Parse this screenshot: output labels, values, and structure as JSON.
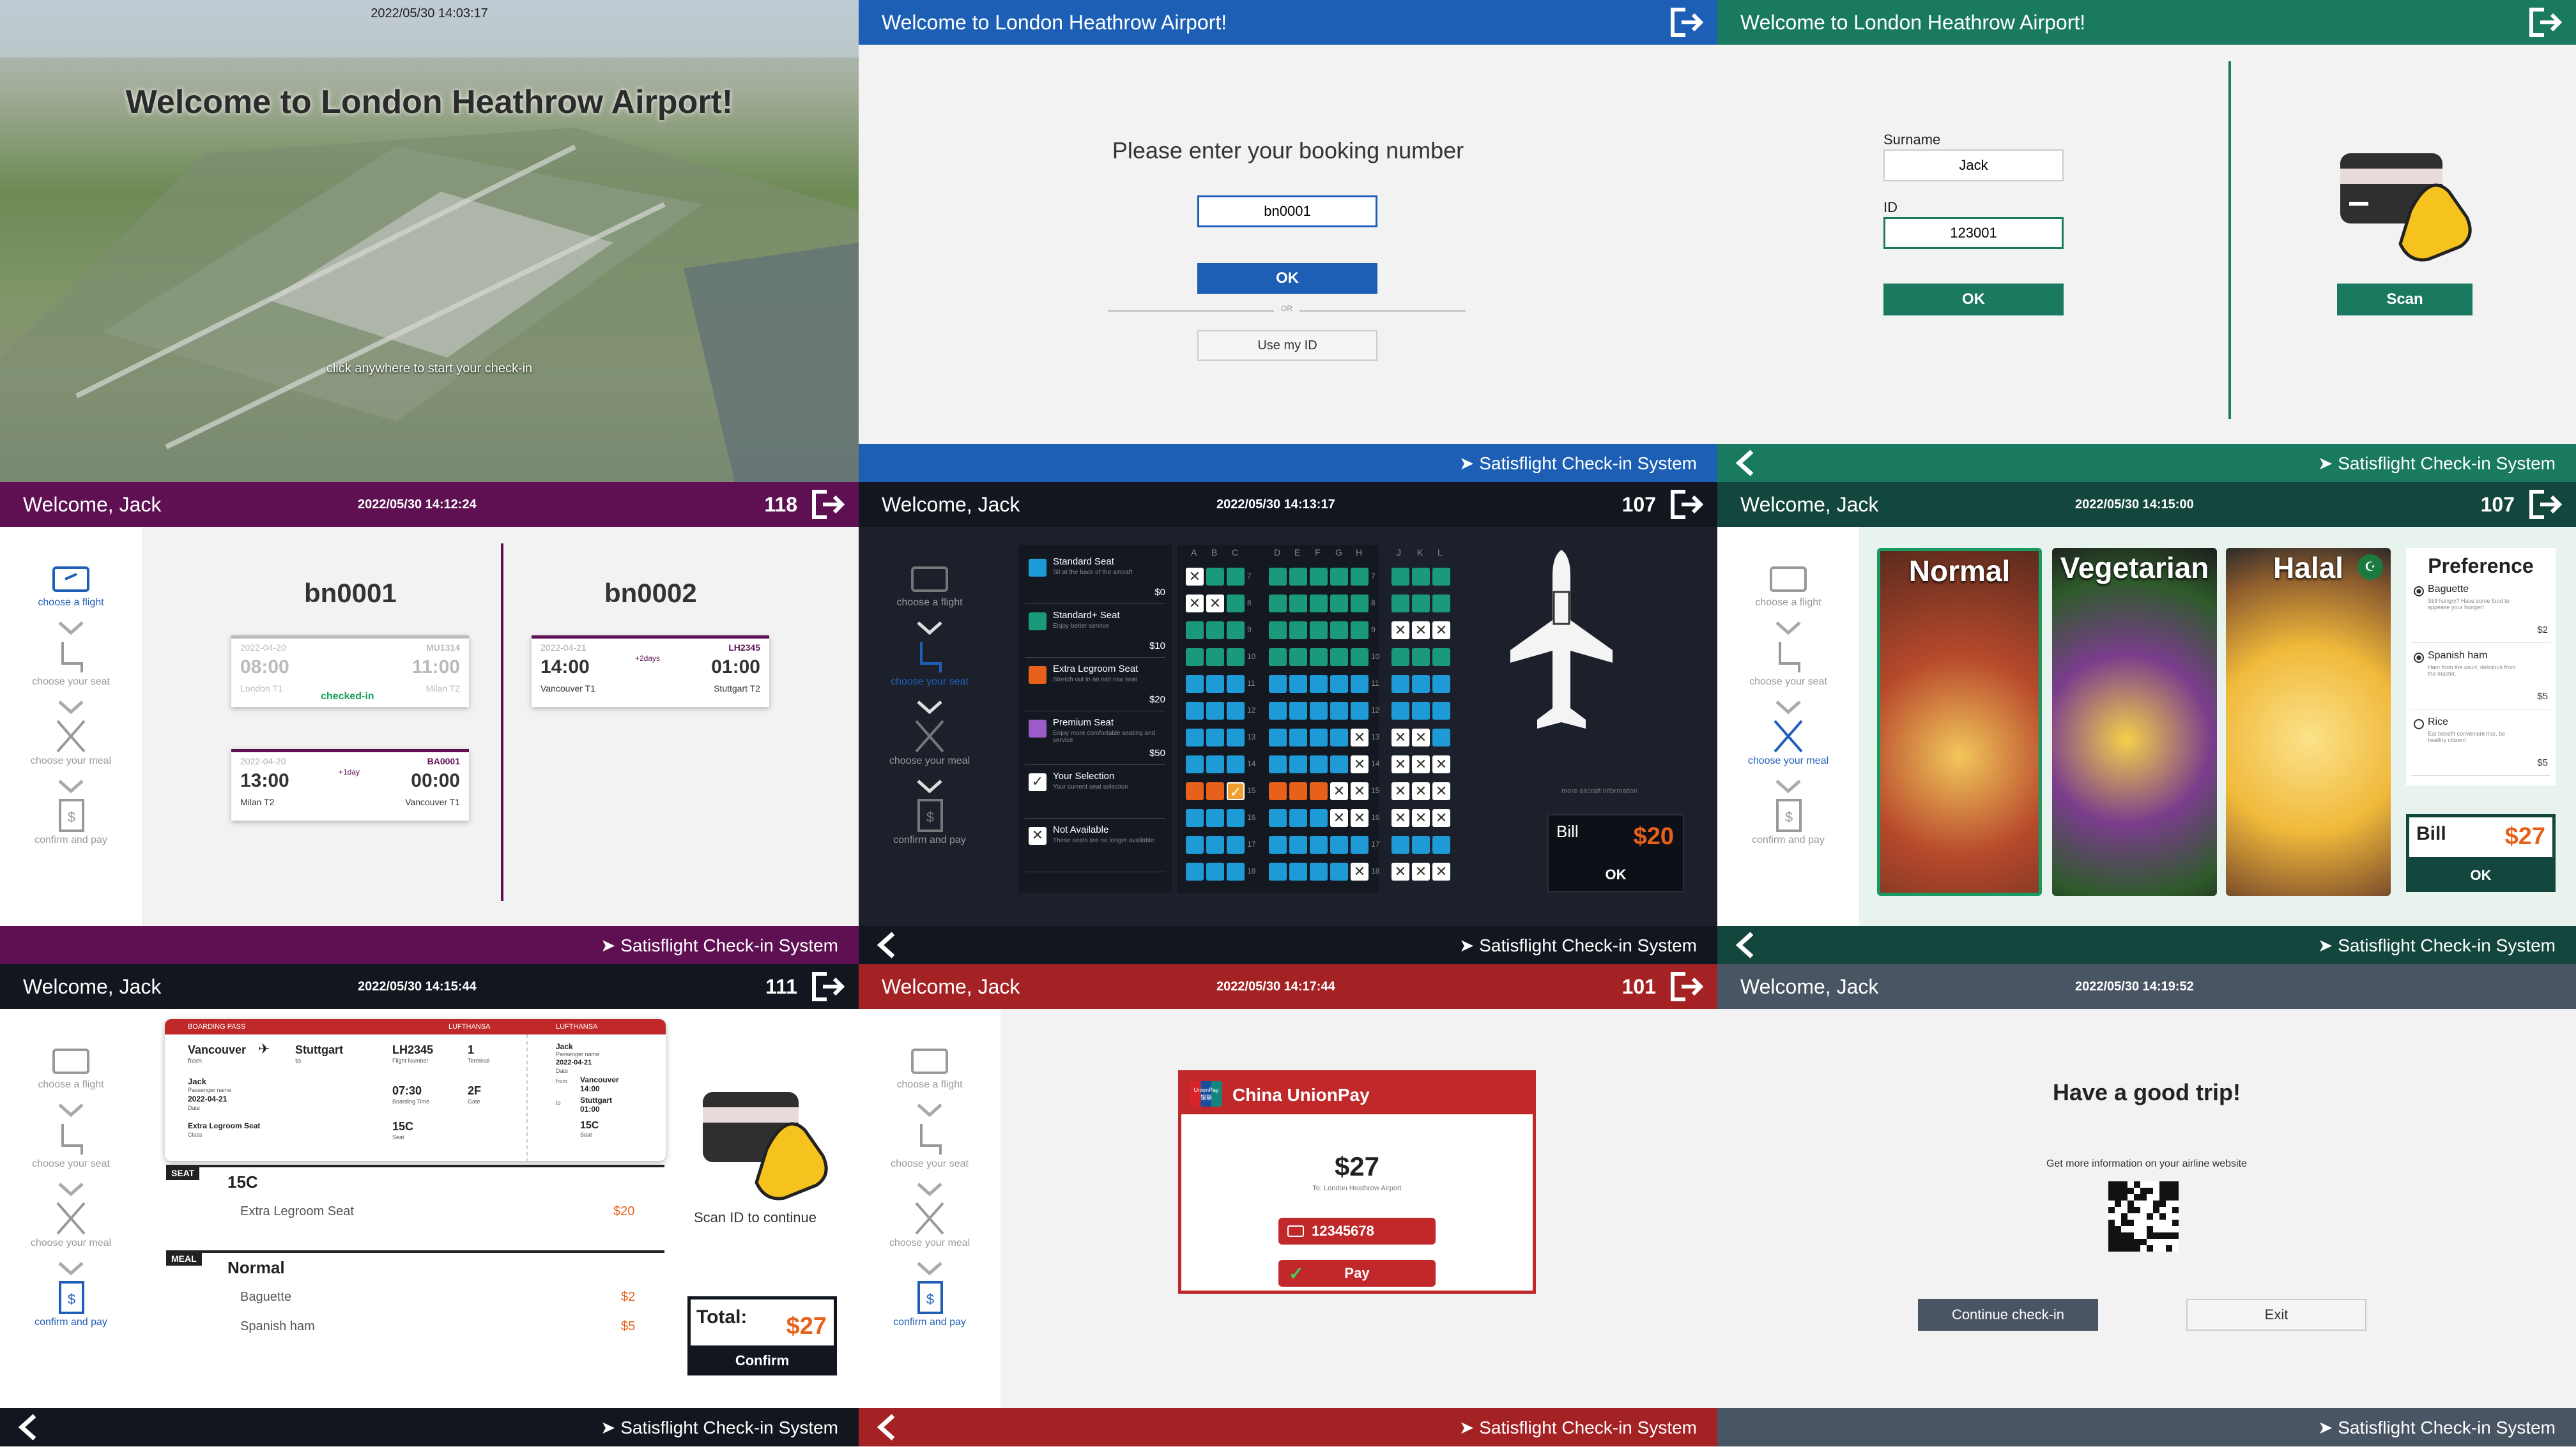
{
  "colors": {
    "blue": "#1d5fb4",
    "green": "#1a7a5f",
    "purple": "#5e1052",
    "navy": "#11161f",
    "darkgreen": "#13473e",
    "red": "#a52224",
    "slate": "#4a5563",
    "accent_orange": "#e8611b"
  },
  "p1": {
    "timestamp": "2022/05/30  14:03:17",
    "title": "Welcome to London Heathrow Airport!",
    "hint": "click anywhere to start your check-in"
  },
  "p2": {
    "header": "Welcome to London Heathrow Airport!",
    "prompt": "Please enter your booking number",
    "booking_value": "bn0001",
    "ok": "OK",
    "or": "OR",
    "use_id": "Use my ID",
    "brand": "Satisflight Check-in System"
  },
  "p3": {
    "header": "Welcome to London Heathrow Airport!",
    "surname_label": "Surname",
    "surname_value": "Jack",
    "id_label": "ID",
    "id_value": "123001",
    "ok": "OK",
    "scan": "Scan",
    "brand": "Satisflight Check-in System"
  },
  "steps": {
    "flight": "choose a flight",
    "seat": "choose your seat",
    "meal": "choose your meal",
    "pay": "confirm and pay"
  },
  "p4": {
    "welcome": "Welcome, Jack",
    "timestamp": "2022/05/30  14:12:24",
    "counter": "118",
    "brand": "Satisflight Check-in System",
    "booking1": "bn0001",
    "booking2": "bn0002",
    "t1": {
      "date": "2022-04-20",
      "code": "MU1314",
      "dep": "08:00",
      "arr": "11:00",
      "from": "London T1",
      "to": "Milan T2",
      "status": "checked-in"
    },
    "t2": {
      "date": "2022-04-20",
      "code": "BA0001",
      "dep": "13:00",
      "arr": "00:00",
      "from": "Milan T2",
      "to": "Vancouver T1",
      "extra": "+1day"
    },
    "t3": {
      "date": "2022-04-21",
      "code": "LH2345",
      "dep": "14:00",
      "arr": "01:00",
      "from": "Vancouver T1",
      "to": "Stuttgart T2",
      "extra": "+2days"
    }
  },
  "p5": {
    "welcome": "Welcome, Jack",
    "timestamp": "2022/05/30  14:13:17",
    "counter": "107",
    "brand": "Satisflight Check-in System",
    "legend": [
      {
        "name": "Standard Seat",
        "desc": "Sit at the back of the aircraft",
        "price": "$0"
      },
      {
        "name": "Standard+ Seat",
        "desc": "Enjoy better service",
        "price": "$10"
      },
      {
        "name": "Extra Legroom Seat",
        "desc": "Stretch out in an exit row seat",
        "price": "$20"
      },
      {
        "name": "Premium Seat",
        "desc": "Enjoy more comfortable seating and service",
        "price": "$50"
      },
      {
        "name": "Your Selection",
        "desc": "Your current seat selection",
        "price": ""
      },
      {
        "name": "Not Available",
        "desc": "These seats are no longer available",
        "price": ""
      }
    ],
    "cols": [
      "A",
      "B",
      "C",
      "D",
      "E",
      "F",
      "G",
      "H",
      "J",
      "K",
      "L"
    ],
    "rows": [
      "7",
      "8",
      "9",
      "10",
      "11",
      "12",
      "13",
      "14",
      "15",
      "16",
      "17",
      "18"
    ],
    "more": "more aircraft information",
    "bill": "Bill",
    "amount": "$20",
    "ok": "OK"
  },
  "p6": {
    "welcome": "Welcome, Jack",
    "timestamp": "2022/05/30  14:15:00",
    "counter": "107",
    "brand": "Satisflight Check-in System",
    "meals": [
      "Normal",
      "Vegetarian",
      "Halal"
    ],
    "pref_title": "Preference",
    "prefs": [
      {
        "name": "Baguette",
        "desc": "Still hungry? Have some food to appease your hunger!",
        "price": "$2"
      },
      {
        "name": "Spanish ham",
        "desc": "Ham from the court, delicious from the master.",
        "price": "$5"
      },
      {
        "name": "Rice",
        "desc": "Eat benefit convenient rice, be healthy citizen!",
        "price": "$5"
      }
    ],
    "bill": "Bill",
    "amount": "$27",
    "ok": "OK"
  },
  "p7": {
    "welcome": "Welcome, Jack",
    "timestamp": "2022/05/30  14:15:44",
    "counter": "111",
    "brand": "Satisflight Check-in System",
    "bp": {
      "head": "BOARDING PASS",
      "airline": "LUFTHANSA",
      "from": "Vancouver",
      "to": "Stuttgart",
      "from_sub": "from",
      "to_sub": "to",
      "flight": "LH2345",
      "flight_sub": "Flight Number",
      "terminal": "1",
      "terminal_sub": "Terminal",
      "name": "Jack",
      "name_sub": "Passenger name",
      "date": "2022-04-21",
      "date_sub": "Date",
      "boarding": "07:30",
      "boarding_sub": "Boarding Time",
      "gate": "2F",
      "gate_sub": "Gate",
      "class": "Extra Legroom Seat",
      "class_sub": "Class",
      "seat": "15C",
      "seat_sub": "Seat",
      "stub": {
        "name": "Jack",
        "name_sub": "Passenger name",
        "date": "2022-04-21",
        "date_sub": "Date",
        "from_label": "from",
        "from": "Vancouver",
        "dep": "14:00",
        "to_label": "to",
        "to": "Stuttgart",
        "arr": "01:00",
        "seat": "15C",
        "seat_sub": "Seat"
      }
    },
    "seat_tag": "SEAT",
    "seat_val": "15C",
    "seat_item": "Extra Legroom Seat",
    "seat_price": "$20",
    "meal_tag": "MEAL",
    "meal_val": "Normal",
    "meal_items": [
      {
        "name": "Baguette",
        "price": "$2"
      },
      {
        "name": "Spanish ham",
        "price": "$5"
      }
    ],
    "scan_text": "Scan ID to continue",
    "total_label": "Total:",
    "total": "$27",
    "confirm": "Confirm"
  },
  "p8": {
    "welcome": "Welcome, Jack",
    "timestamp": "2022/05/30  14:17:44",
    "counter": "101",
    "brand": "Satisflight Check-in System",
    "provider": "China UnionPay",
    "logo_top": "UnionPay",
    "logo_bottom": "银联",
    "amount": "$27",
    "to": "To: London Heathrow Airport",
    "card": "12345678",
    "pay": "Pay"
  },
  "p9": {
    "welcome": "Welcome, Jack",
    "timestamp": "2022/05/30  14:19:52",
    "brand": "Satisflight Check-in System",
    "title": "Have a good trip!",
    "info": "Get more information on your airline website",
    "continue": "Continue check-in",
    "exit": "Exit"
  }
}
